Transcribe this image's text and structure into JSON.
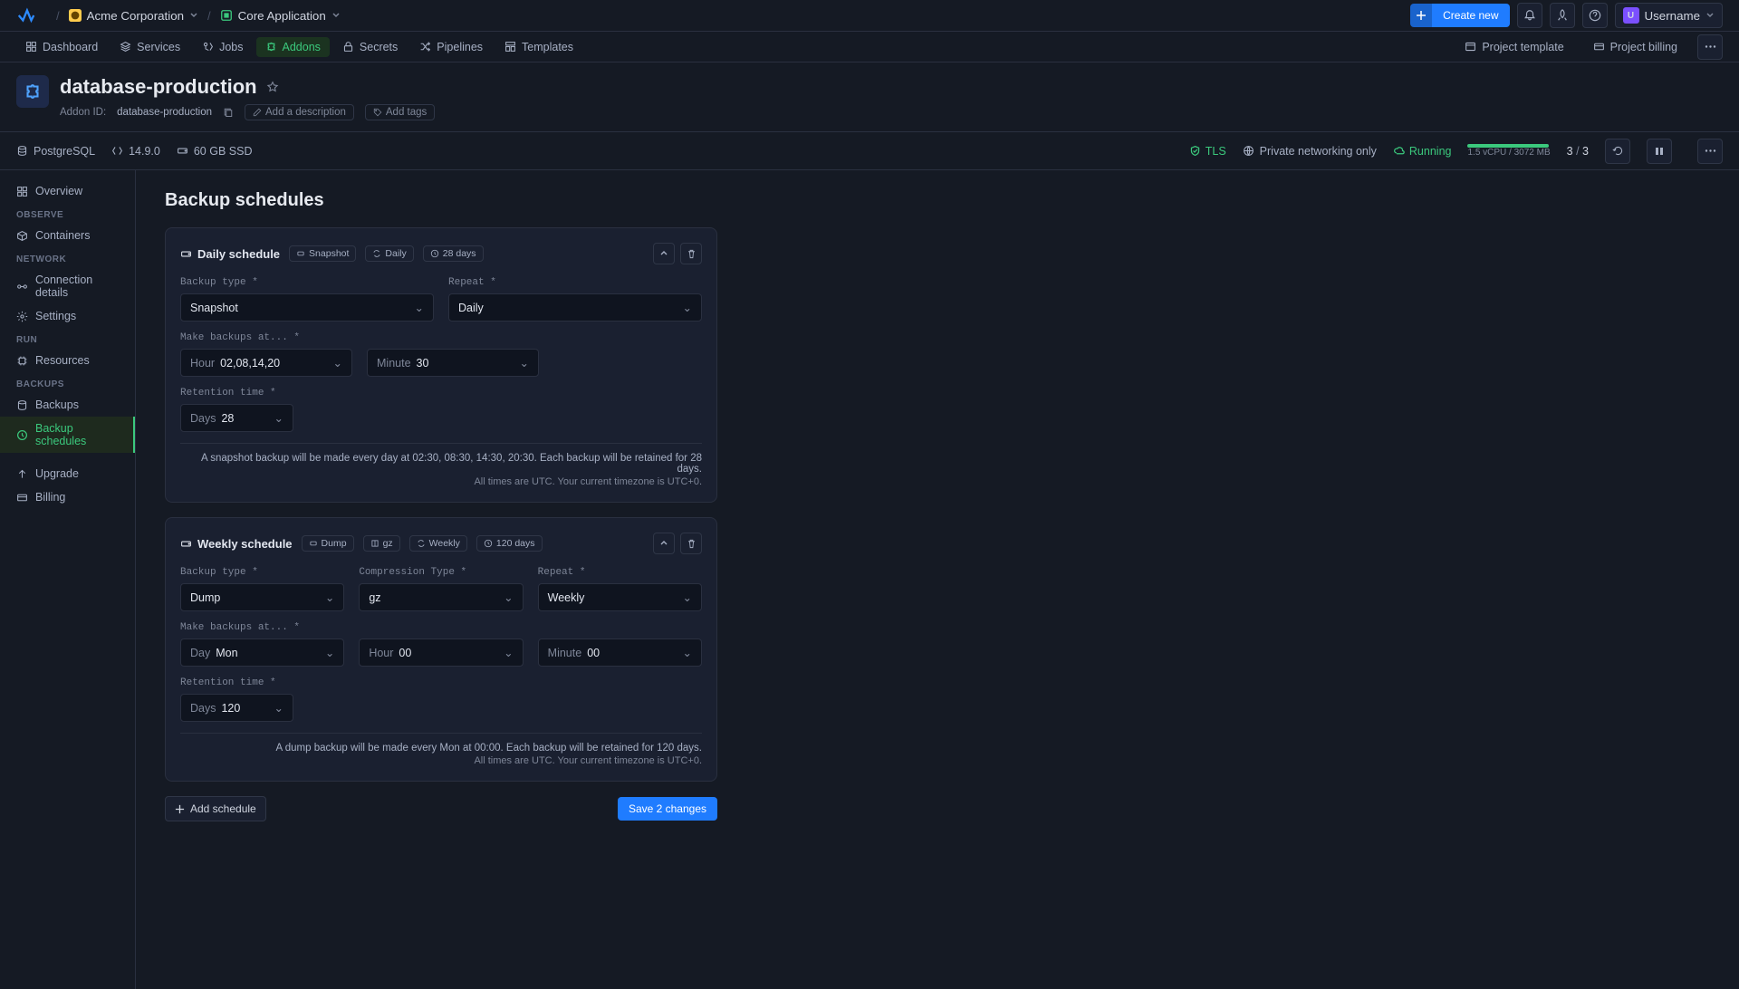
{
  "breadcrumb": {
    "org": "Acme Corporation",
    "app": "Core Application"
  },
  "topbar": {
    "create": "Create new",
    "username": "Username",
    "avatar_initial": "U"
  },
  "tabs": {
    "dashboard": "Dashboard",
    "services": "Services",
    "jobs": "Jobs",
    "addons": "Addons",
    "secrets": "Secrets",
    "pipelines": "Pipelines",
    "templates": "Templates",
    "project_template": "Project template",
    "project_billing": "Project billing"
  },
  "header": {
    "title": "database-production",
    "addon_id_label": "Addon ID:",
    "addon_id": "database-production",
    "add_desc": "Add a description",
    "add_tags": "Add tags"
  },
  "statusbar": {
    "engine": "PostgreSQL",
    "version": "14.9.0",
    "disk": "60 GB SSD",
    "tls": "TLS",
    "networking": "Private networking only",
    "status": "Running",
    "usage_label": "1.5 vCPU / 3072 MB",
    "count_current": "3",
    "count_sep": "/",
    "count_total": "3",
    "usage_percent": 100
  },
  "sidebar": {
    "overview": "Overview",
    "groups": {
      "observe": "OBSERVE",
      "network": "NETWORK",
      "run": "RUN",
      "backups": "BACKUPS"
    },
    "items": {
      "containers": "Containers",
      "connection": "Connection details",
      "settings": "Settings",
      "resources": "Resources",
      "backups": "Backups",
      "schedules": "Backup schedules",
      "upgrade": "Upgrade",
      "billing": "Billing"
    }
  },
  "content": {
    "title": "Backup schedules",
    "daily": {
      "title": "Daily schedule",
      "chip_type": "Snapshot",
      "chip_repeat": "Daily",
      "chip_ret": "28 days",
      "backup_type_label": "Backup type *",
      "backup_type": "Snapshot",
      "repeat_label": "Repeat *",
      "repeat": "Daily",
      "make_label": "Make backups at... *",
      "hour_label": "Hour",
      "hour": "02,08,14,20",
      "minute_label": "Minute",
      "minute": "30",
      "retention_label": "Retention time *",
      "days_label": "Days",
      "days": "28",
      "note1": "A snapshot backup will be made every day at 02:30, 08:30, 14:30, 20:30. Each backup will be retained for 28 days.",
      "note2": "All times are UTC. Your current timezone is UTC+0."
    },
    "weekly": {
      "title": "Weekly schedule",
      "chip_type": "Dump",
      "chip_comp": "gz",
      "chip_repeat": "Weekly",
      "chip_ret": "120 days",
      "backup_type_label": "Backup type *",
      "backup_type": "Dump",
      "comp_label": "Compression Type *",
      "comp": "gz",
      "repeat_label": "Repeat *",
      "repeat": "Weekly",
      "make_label": "Make backups at... *",
      "day_label": "Day",
      "day": "Mon",
      "hour_label": "Hour",
      "hour": "00",
      "minute_label": "Minute",
      "minute": "00",
      "retention_label": "Retention time *",
      "days_label": "Days",
      "days": "120",
      "note1": "A dump backup will be made every Mon at 00:00. Each backup will be retained for 120 days.",
      "note2": "All times are UTC. Your current timezone is UTC+0."
    },
    "add_schedule": "Add schedule",
    "save": "Save 2 changes"
  }
}
